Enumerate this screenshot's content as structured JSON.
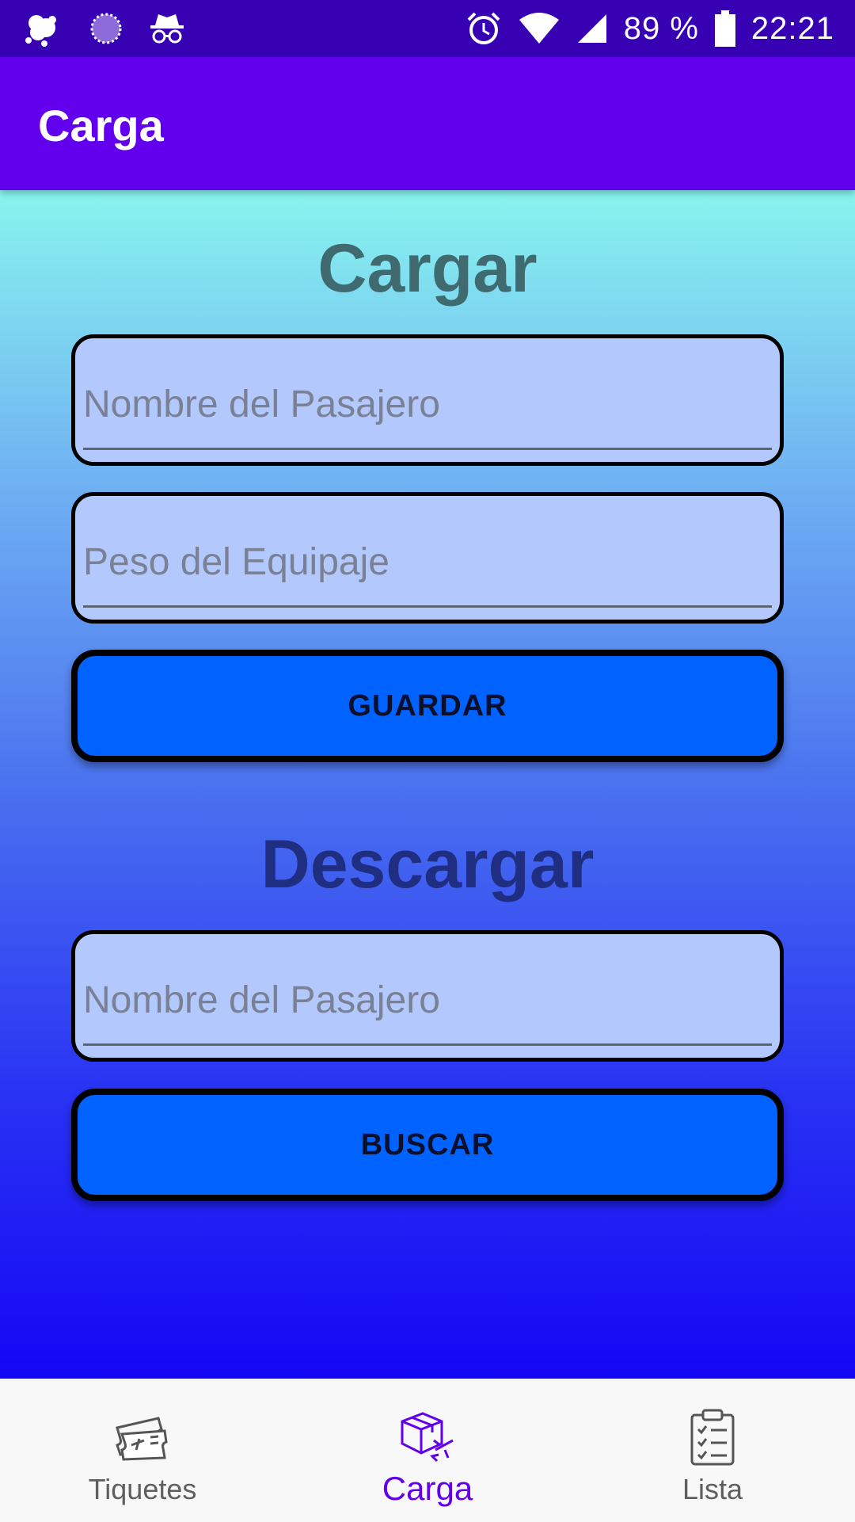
{
  "status_bar": {
    "battery_text": "89 %",
    "time": "22:21",
    "icons": [
      "weather-icon",
      "loading-icon",
      "incognito-icon",
      "alarm-icon",
      "wifi-icon",
      "signal-icon",
      "battery-icon"
    ]
  },
  "app_bar": {
    "title": "Carga"
  },
  "cargar": {
    "heading": "Cargar",
    "passenger_placeholder": "Nombre del Pasajero",
    "weight_placeholder": "Peso del Equipaje",
    "save_label": "GUARDAR"
  },
  "descargar": {
    "heading": "Descargar",
    "passenger_placeholder": "Nombre del Pasajero",
    "search_label": "BUSCAR"
  },
  "bottom_nav": {
    "items": [
      {
        "label": "Tiquetes",
        "icon": "ticket-icon",
        "active": false
      },
      {
        "label": "Carga",
        "icon": "cargo-icon",
        "active": true
      },
      {
        "label": "Lista",
        "icon": "checklist-icon",
        "active": false
      }
    ]
  },
  "colors": {
    "status_bar": "#3700b3",
    "app_bar": "#6200ee",
    "button": "#0062ff",
    "field": "#b3c8fd",
    "active_nav": "#6200ee"
  }
}
